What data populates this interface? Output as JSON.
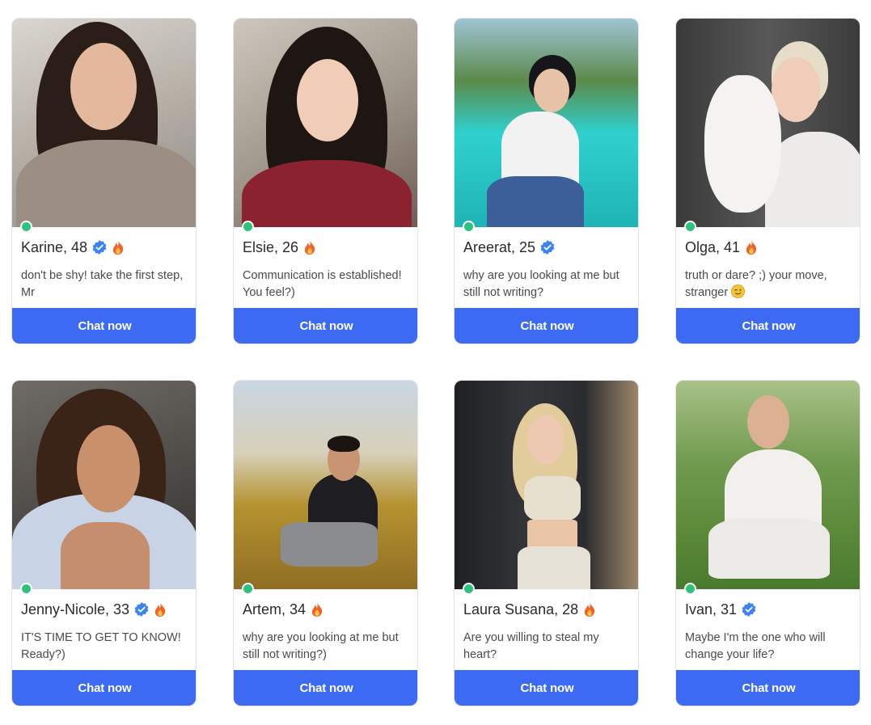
{
  "colors": {
    "accent": "#3d6af2",
    "online": "#2ec27e",
    "verified": "#3b82f6",
    "fire": "#f0642a"
  },
  "profiles": [
    {
      "name": "Karine, 48",
      "verified": true,
      "hot": true,
      "status": "don't be shy! take the first step, Mr",
      "cta": "Chat now",
      "online": true
    },
    {
      "name": "Elsie, 26",
      "verified": false,
      "hot": true,
      "status": "Communication is established! You feel?)",
      "cta": "Chat now",
      "online": true
    },
    {
      "name": "Areerat, 25",
      "verified": true,
      "hot": false,
      "status": "why are you looking at me but still not writing?",
      "cta": "Chat now",
      "online": true
    },
    {
      "name": "Olga, 41",
      "verified": false,
      "hot": true,
      "status": "truth or dare? ;) your move, stranger",
      "status_emoji": "wink-face-icon",
      "cta": "Chat now",
      "online": true
    },
    {
      "name": "Jenny-Nicole, 33",
      "verified": true,
      "hot": true,
      "status": "IT'S TIME TO GET TO KNOW! Ready?)",
      "cta": "Chat now",
      "online": true
    },
    {
      "name": "Artem, 34",
      "verified": false,
      "hot": true,
      "status": "why are you looking at me but still not writing?)",
      "cta": "Chat now",
      "online": true
    },
    {
      "name": "Laura Susana, 28",
      "verified": false,
      "hot": true,
      "status": "Are you willing to steal my heart?",
      "cta": "Chat now",
      "online": true
    },
    {
      "name": "Ivan, 31",
      "verified": true,
      "hot": false,
      "status": "Maybe I'm the one who will change your life?",
      "cta": "Chat now",
      "online": true
    }
  ]
}
